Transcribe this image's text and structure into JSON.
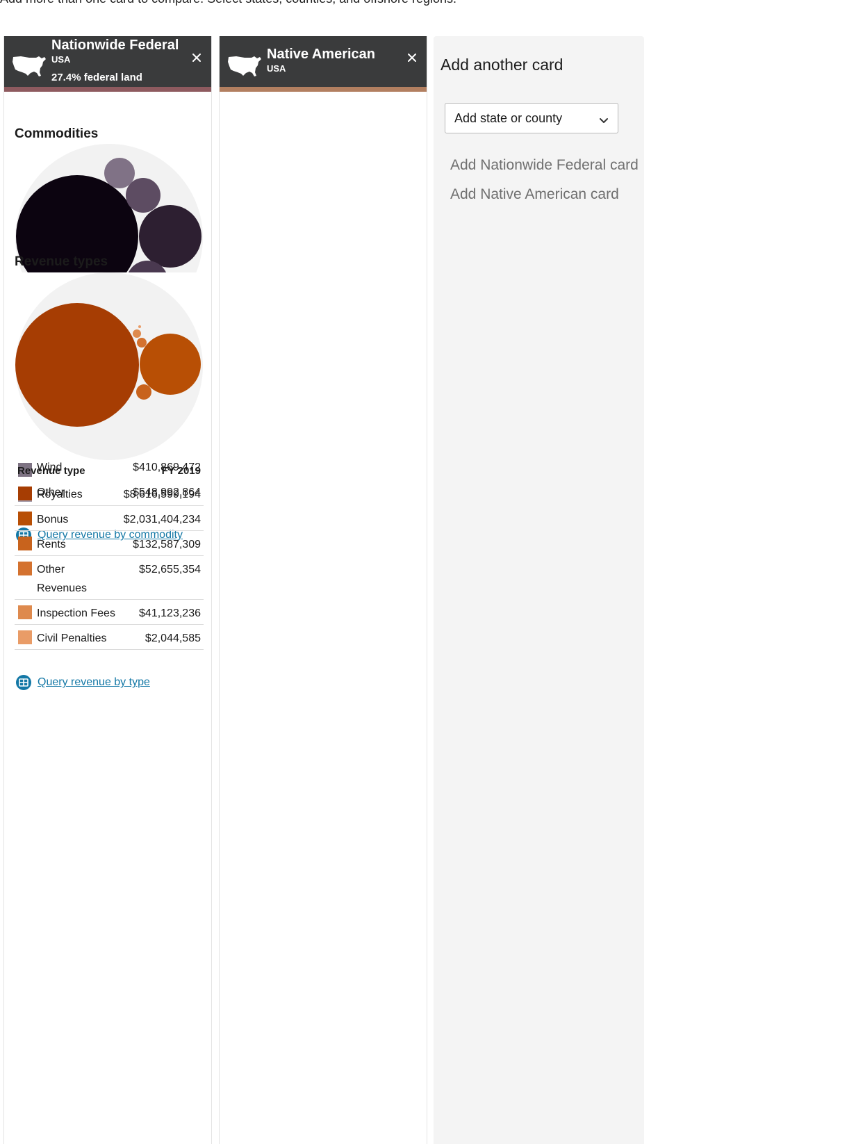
{
  "intro": "Add more than one card to compare. Select states, counties, and offshore regions.",
  "cards": [
    {
      "title": "Nationwide Federal",
      "subtitle": "USA",
      "land_text": "27.4% federal land",
      "icon": "usa-map-icon",
      "accent_bar": "#8e5a5f",
      "commodities": {
        "title": "Commodities",
        "ghost_rows": [
          {
            "name": "Wind",
            "value": "$410,869,472",
            "color": "#7e7383"
          },
          {
            "name": "Other",
            "value": "$548,992,864",
            "color": "#a39aa7"
          }
        ],
        "query_label": "Query revenue by commodity",
        "chart_data": {
          "type": "bubble",
          "bubble_colors": [
            "#0c0410",
            "#2d1f31",
            "#5d4c62",
            "#807286",
            "#4a3950"
          ]
        }
      },
      "revenue_types": {
        "title": "Revenue types",
        "col_name": "Revenue type",
        "col_year": "FY 2019",
        "rows": [
          {
            "name": "Royalties",
            "value": "$8,616,599,194",
            "color": "#a63d03"
          },
          {
            "name": "Bonus",
            "value": "$2,031,404,234",
            "color": "#b84f05"
          },
          {
            "name": "Rents",
            "value": "$132,587,309",
            "color": "#c8631d"
          },
          {
            "name": "Other Revenues",
            "value": "$52,655,354",
            "color": "#d4722f"
          },
          {
            "name": "Inspection Fees",
            "value": "$41,123,236",
            "color": "#de8a4e"
          },
          {
            "name": "Civil Penalties",
            "value": "$2,044,585",
            "color": "#e99c67"
          }
        ],
        "query_label": "Query revenue by type",
        "chart_data": {
          "type": "bubble",
          "categories": [
            "Royalties",
            "Bonus",
            "Rents",
            "Other Revenues",
            "Inspection Fees",
            "Civil Penalties"
          ],
          "values": [
            8616599194,
            2031404234,
            132587309,
            52655354,
            41123236,
            2044585
          ]
        }
      }
    },
    {
      "title": "Native American",
      "subtitle": "USA",
      "icon": "usa-map-icon",
      "accent_bar": "#b27f60"
    }
  ],
  "add_card": {
    "title": "Add another card",
    "select_label": "Add state or county",
    "links": [
      "Add Nationwide Federal card",
      "Add Native American card"
    ]
  },
  "colors": {
    "header_bg": "#3a3b3c",
    "link": "#1478a6",
    "add_bg": "#f4f4f4"
  }
}
